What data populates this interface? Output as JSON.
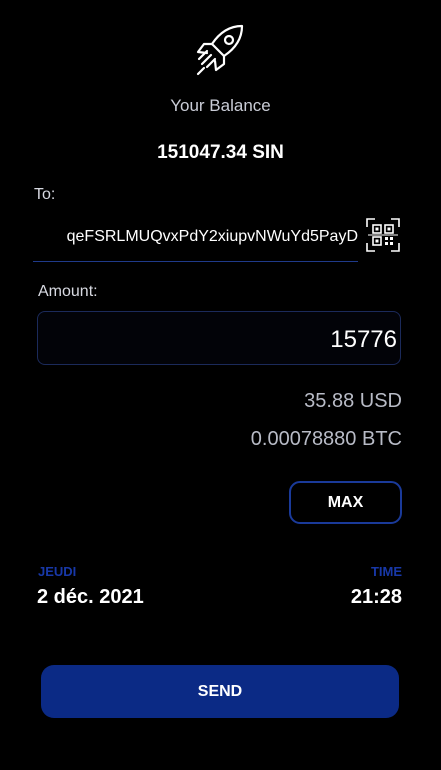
{
  "header": {
    "icon": "rocket-icon",
    "balance_label": "Your Balance",
    "balance_value": "151047.34 SIN"
  },
  "recipient": {
    "label": "To:",
    "address": "qeFSRLMUQvxPdY2xiupvNWuYd5PayD",
    "scan_icon": "qr-scan-icon"
  },
  "amount": {
    "label": "Amount:",
    "value": "15776",
    "usd_equivalent": "35.88 USD",
    "btc_equivalent": "0.00078880 BTC",
    "max_label": "MAX"
  },
  "datetime": {
    "day_label": "JEUDI",
    "date": "2 déc. 2021",
    "time_label": "TIME",
    "time": "21:28"
  },
  "actions": {
    "send_label": "SEND"
  },
  "colors": {
    "background": "#000000",
    "accent": "#0b2a85",
    "label_blue": "#1838a8",
    "border_blue": "#1a3a9a"
  }
}
